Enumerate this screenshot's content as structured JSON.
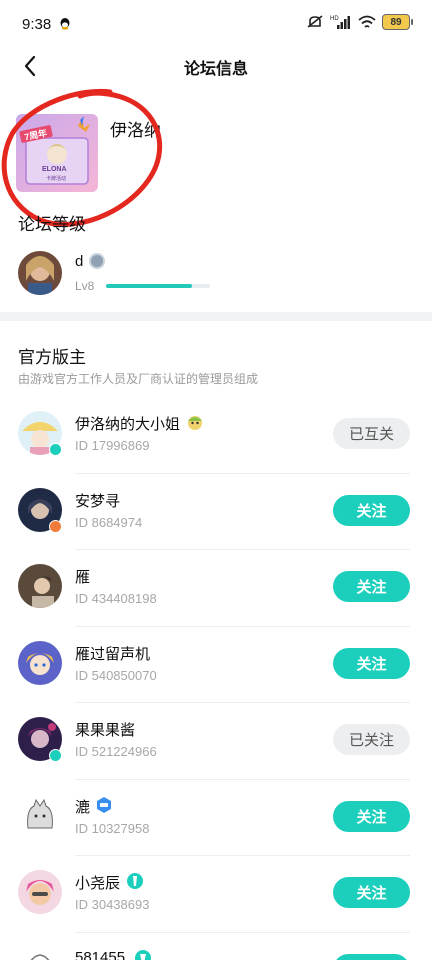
{
  "status_bar": {
    "time": "9:38",
    "battery": "89",
    "hd_label": "HD"
  },
  "nav": {
    "title": "论坛信息"
  },
  "forum": {
    "name": "伊洛纳",
    "cover_text": "ELONA",
    "cover_badge": "7周年",
    "cover_caption": "卡牌活动"
  },
  "level_section": {
    "title": "论坛等级",
    "user": {
      "name": "d",
      "level": "Lv8",
      "progress": 0.83
    }
  },
  "moderators": {
    "title": "官方版主",
    "subtitle": "由游戏官方工作人员及厂商认证的管理员组成",
    "items": [
      {
        "name": "伊洛纳的大小姐",
        "id": "ID 17996869",
        "button": "已互关",
        "state": "done"
      },
      {
        "name": "安梦寻",
        "id": "ID 8684974",
        "button": "关注",
        "state": "active"
      },
      {
        "name": "雁",
        "id": "ID 434408198",
        "button": "关注",
        "state": "active"
      },
      {
        "name": "雁过留声机",
        "id": "ID 540850070",
        "button": "关注",
        "state": "active"
      },
      {
        "name": "果果果酱",
        "id": "ID 521224966",
        "button": "已关注",
        "state": "done"
      },
      {
        "name": "漉",
        "id": "ID 10327958",
        "button": "关注",
        "state": "active"
      },
      {
        "name": "小尧辰",
        "id": "ID 30438693",
        "button": "关注",
        "state": "active"
      },
      {
        "name": "581455",
        "id": "",
        "button": "关注",
        "state": "active"
      }
    ]
  },
  "colors": {
    "accent": "#1ccfbc",
    "annotation_red": "#e5281f"
  }
}
